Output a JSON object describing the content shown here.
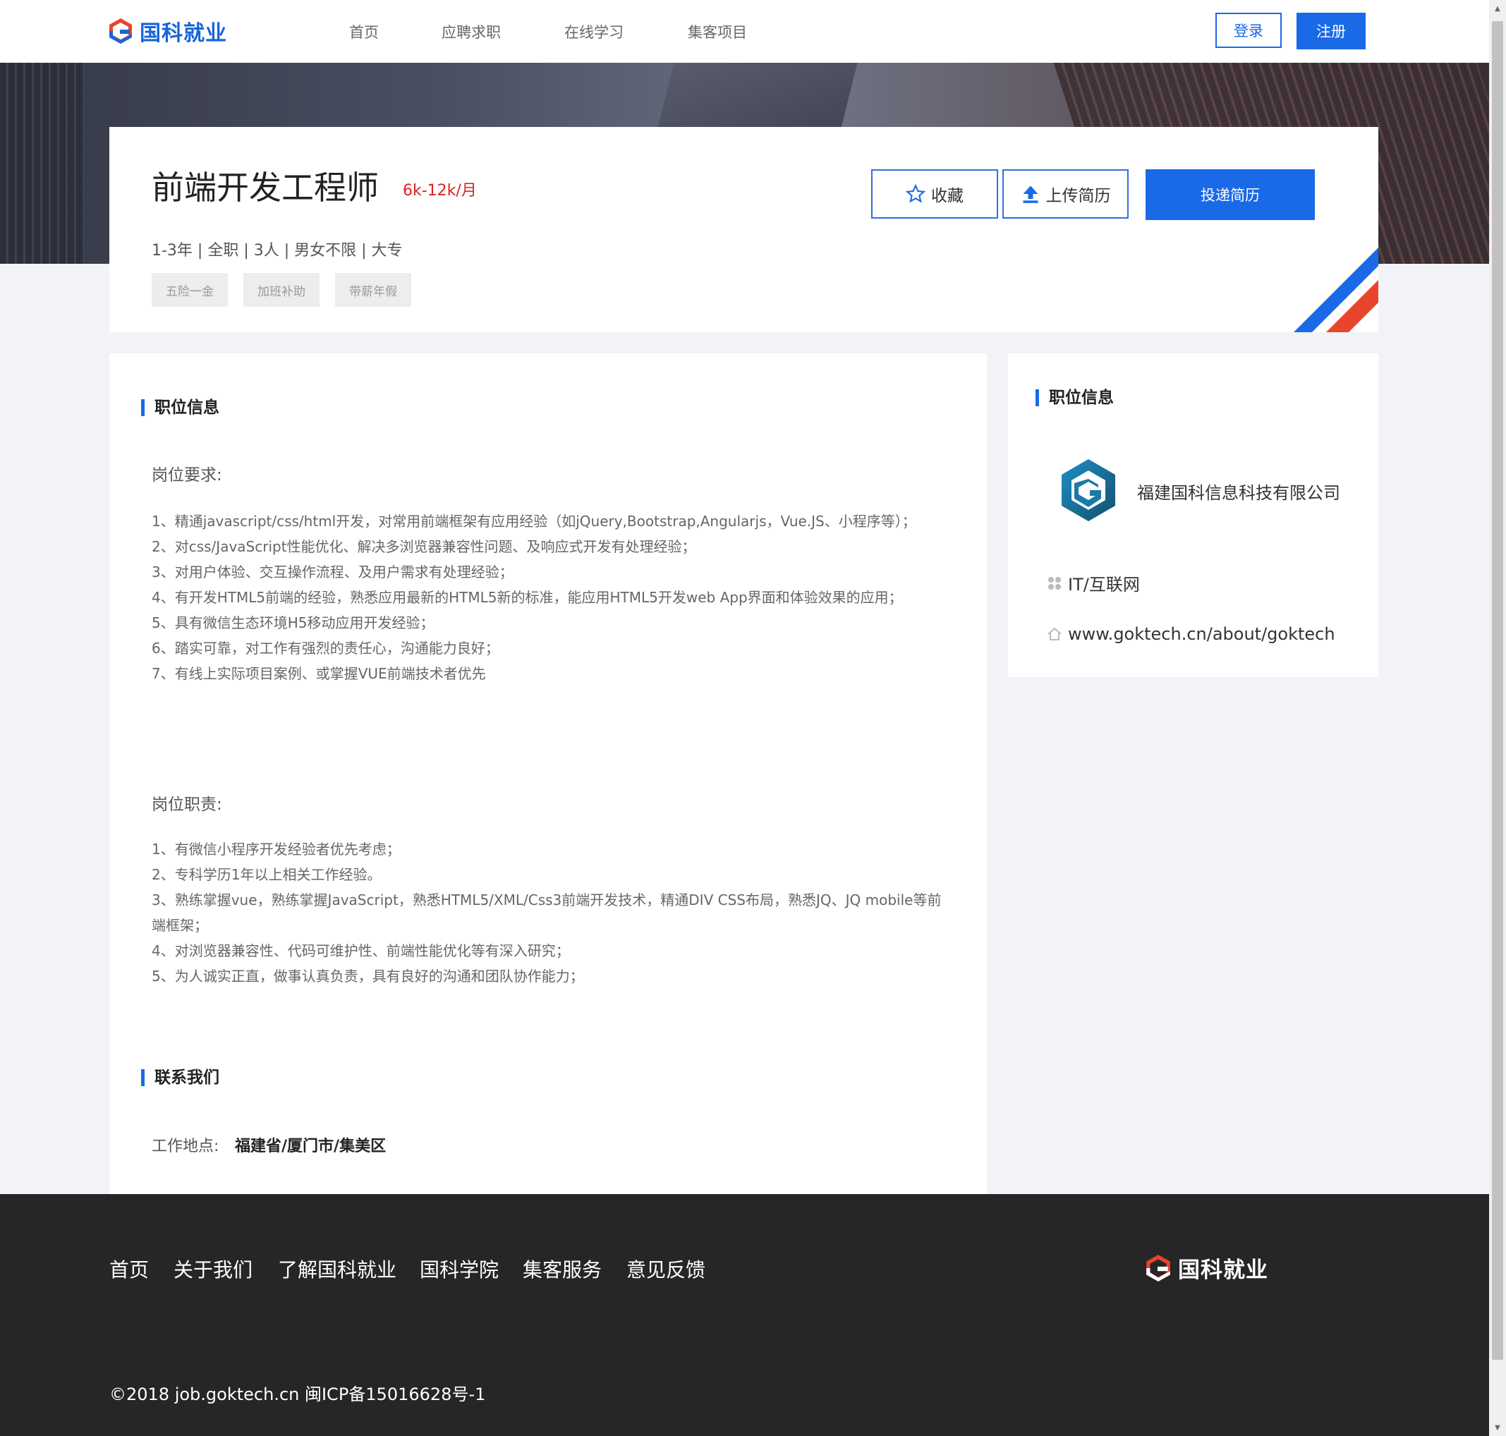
{
  "header": {
    "logo_text": "国科就业",
    "nav": [
      "首页",
      "应聘求职",
      "在线学习",
      "集客项目"
    ],
    "login": "登录",
    "register": "注册"
  },
  "job": {
    "title": "前端开发工程师",
    "salary": "6k-12k/月",
    "meta": "1-3年 | 全职 | 3人 | 男女不限 | 大专",
    "tags": [
      "五险一金",
      "加班补助",
      "带薪年假"
    ],
    "favorite": "收藏",
    "upload": "上传简历",
    "apply": "投递简历"
  },
  "main": {
    "section_title": "职位信息",
    "requirements_heading": "岗位要求:",
    "requirements": [
      " 1、精通javascript/css/html开发，对常用前端框架有应用经验（如jQuery,Bootstrap,Angularjs，Vue.JS、小程序等）；",
      "2、对css/JavaScript性能优化、解决多浏览器兼容性问题、及响应式开发有处理经验；",
      "3、对用户体验、交互操作流程、及用户需求有处理经验；",
      "4、有开发HTML5前端的经验，熟悉应用最新的HTML5新的标准，能应用HTML5开发web App界面和体验效果的应用；",
      "5、具有微信生态环境H5移动应用开发经验；",
      "6、踏实可靠，对工作有强烈的责任心，沟通能力良好；",
      "7、有线上实际项目案例、或掌握VUE前端技术者优先"
    ],
    "duties_heading": "岗位职责:",
    "duties": [
      "1、有微信小程序开发经验者优先考虑；",
      "2、专科学历1年以上相关工作经验。",
      "3、熟练掌握vue，熟练掌握JavaScript，熟悉HTML5/XML/Css3前端开发技术，精通DIV CSS布局，熟悉JQ、JQ mobile等前端框架；",
      "4、对浏览器兼容性、代码可维护性、前端性能优化等有深入研究；",
      "5、为人诚实正直，做事认真负责，具有良好的沟通和团队协作能力；"
    ],
    "contact_title": "联系我们",
    "location_label": "工作地点:",
    "location_value": "福建省/厦门市/集美区"
  },
  "sidebar": {
    "title": "职位信息",
    "company": "福建国科信息科技有限公司",
    "industry": "IT/互联网",
    "website": "www.goktech.cn/about/goktech"
  },
  "footer": {
    "links": [
      "首页",
      "关于我们",
      "了解国科就业",
      "国科学院",
      "集客服务",
      "意见反馈"
    ],
    "logo_text": "国科就业",
    "copyright": "©2018 job.goktech.cn 闽ICP备15016628号-1"
  },
  "colors": {
    "accent": "#1a6ae8",
    "salary": "#e02020",
    "footer_bg": "#262626",
    "page_bg": "#f2f3f6"
  }
}
